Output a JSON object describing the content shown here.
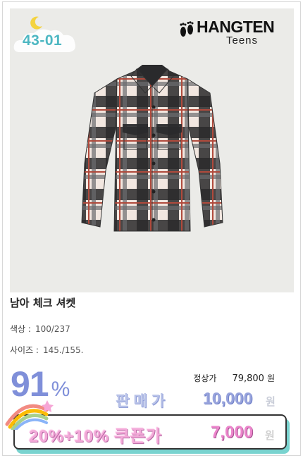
{
  "product": {
    "code": "43-01",
    "brand_name": "HANGTEN",
    "brand_sub": "Teens",
    "title": "남아 체크 셔켓",
    "options": [
      {
        "label": "색상 :",
        "value": "100/237"
      },
      {
        "label": "사이즈 :",
        "value": "145./155."
      }
    ]
  },
  "pricing": {
    "discount_value": "91",
    "discount_unit": "%",
    "regular_label": "정상가",
    "regular_price": "79,800",
    "regular_unit": "원",
    "sale_label": "판매가",
    "sale_price": "10,000",
    "sale_unit": "원",
    "coupon_label": "20%+10% 쿠폰가",
    "coupon_price": "7,000",
    "coupon_unit": "원"
  },
  "colors": {
    "accent_blue": "#7f8fd9",
    "coupon_pink": "#ec86cc",
    "mint": "#79d3cf",
    "code_teal": "#4db7c2"
  }
}
